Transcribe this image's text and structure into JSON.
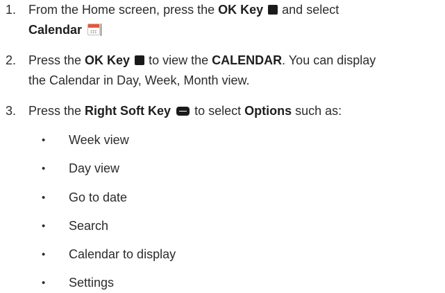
{
  "steps": [
    {
      "number": "1.",
      "line1_pre": "From the Home screen, press the ",
      "line1_key": "OK Key",
      "line1_post": " and select",
      "line2_app": "Calendar",
      "icon_key": "square-key-icon",
      "app_icon": "calendar-app-icon"
    },
    {
      "number": "2.",
      "pre": "Press the ",
      "key": "OK Key",
      "mid": " to view the ",
      "target": "CALENDAR",
      "post": ". You can display",
      "line2": "the Calendar in Day, Week, Month view.",
      "icon_key": "square-key-icon"
    },
    {
      "number": "3.",
      "pre": "Press the ",
      "key": "Right Soft Key",
      "mid": " to select ",
      "target": "Options",
      "post": " such as:",
      "icon_key": "soft-key-icon"
    }
  ],
  "options": {
    "bullet": "•",
    "items": [
      "Week view",
      "Day view",
      "Go to date",
      "Search",
      "Calendar to display",
      "Settings"
    ]
  }
}
